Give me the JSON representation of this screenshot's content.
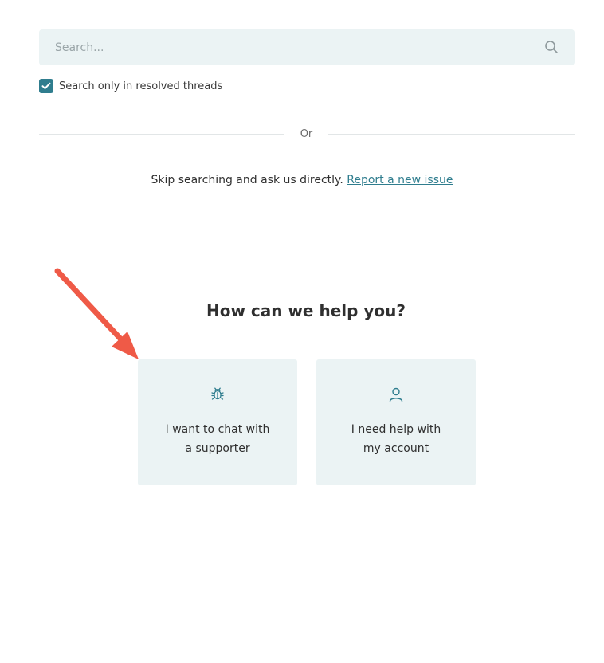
{
  "search": {
    "placeholder": "Search...",
    "icon": "search-icon"
  },
  "filter": {
    "resolved_only_label": "Search only in resolved threads",
    "resolved_only_checked": true
  },
  "divider": {
    "text": "Or"
  },
  "direct": {
    "text": "Skip searching and ask us directly.",
    "link_label": "Report a new issue"
  },
  "help": {
    "title": "How can we help you?",
    "options": [
      {
        "label_line1": "I want to chat with",
        "label_line2": "a supporter",
        "icon": "bug-icon"
      },
      {
        "label_line1": "I need help with",
        "label_line2": "my account",
        "icon": "user-icon"
      }
    ]
  },
  "colors": {
    "accent": "#2f7d8e",
    "card_background": "#ebf3f4",
    "annotation_arrow": "#ef5a47"
  }
}
